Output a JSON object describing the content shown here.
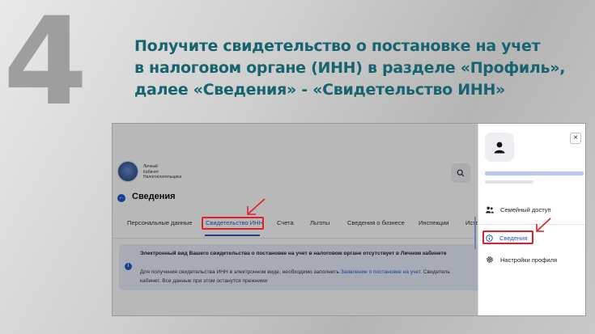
{
  "slide": {
    "step_number": "4",
    "headline_lines": [
      "Получите свидетельство о постановке на учет",
      "в налоговом органе (ИНН) в разделе «Профиль»,",
      "далее  «Сведения» - «Свидетельство ИНН»"
    ]
  },
  "header": {
    "logo_lines": [
      "Личный",
      "Кабинет",
      "Налогоплательщика"
    ],
    "search_icon": "search-icon"
  },
  "page": {
    "title": "Сведения",
    "tabs": [
      {
        "label": "Персональные данные",
        "active": false
      },
      {
        "label": "Свидетельство ИНН",
        "active": true
      },
      {
        "label": "Счета",
        "active": false
      },
      {
        "label": "Льготы",
        "active": false
      },
      {
        "label": "Сведения о бизнесе",
        "active": false
      },
      {
        "label": "Инспекции",
        "active": false
      },
      {
        "label": "Исто",
        "active": false
      }
    ],
    "notice": {
      "title": "Электронный вид Вашего свидетельства о постановке на учет в налоговом органе отсутствует в Личном кабинете",
      "body_prefix": "Для получения свидетельства ИНН в электронном виде, необходимо заполнить ",
      "link": "Заявление о постановке на учет",
      "body_suffix": ". Свидетель",
      "body_line2": "кабинет. Все данные при этом останутся прежними"
    }
  },
  "drawer": {
    "items": [
      {
        "label": "Семейный доступ",
        "icon": "family-icon"
      },
      {
        "label": "Сведения",
        "icon": "info-icon",
        "active": true
      },
      {
        "label": "Настройки профиля",
        "icon": "gear-icon"
      }
    ]
  },
  "colors": {
    "accent": "#2456c9",
    "highlight": "#e0202a",
    "headline": "#166470"
  }
}
